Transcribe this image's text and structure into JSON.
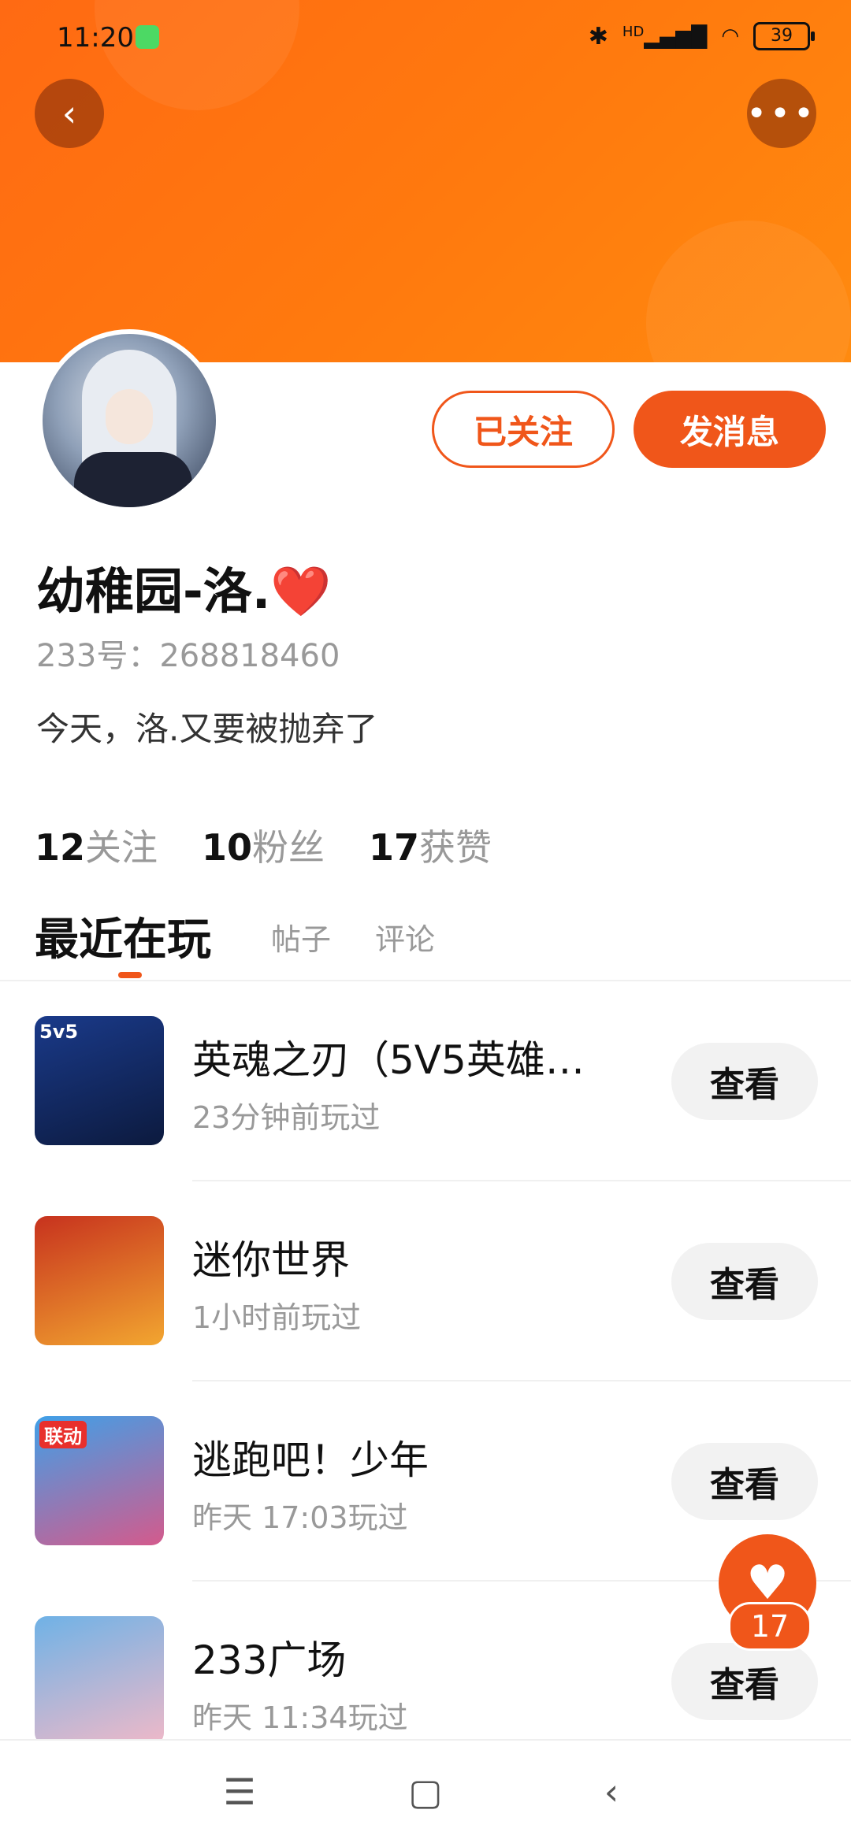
{
  "status_bar": {
    "time": "11:20",
    "signal_label": "HD",
    "battery": "39"
  },
  "header": {
    "back_icon": "chevron-left-icon",
    "more_icon": "more-dots-icon"
  },
  "profile": {
    "follow_button": "已关注",
    "message_button": "发消息",
    "name": "幼稚园-洛.",
    "name_emoji": "❤️",
    "uid": "233号：268818460",
    "bio": "今天，洛.又要被抛弃了"
  },
  "stats": [
    {
      "num": "12",
      "label": "关注"
    },
    {
      "num": "10",
      "label": "粉丝"
    },
    {
      "num": "17",
      "label": "获赞"
    }
  ],
  "tabs": {
    "active": "最近在玩",
    "posts": "帖子",
    "comments": "评论"
  },
  "games": [
    {
      "title": "英魂之刃（5V5英雄…",
      "time": "23分钟前玩过",
      "button": "查看",
      "icon_label": "5v5"
    },
    {
      "title": "迷你世界",
      "time": "1小时前玩过",
      "button": "查看",
      "icon_label": ""
    },
    {
      "title": "逃跑吧！少年",
      "time": "昨天 17:03玩过",
      "button": "查看",
      "icon_label": "联动"
    },
    {
      "title": "233广场",
      "time": "昨天 11:34玩过",
      "button": "查看",
      "icon_label": ""
    }
  ],
  "fab": {
    "count": "17",
    "icon": "heart-icon"
  },
  "colors": {
    "accent": "#f0561a",
    "header_start": "#ff6a13",
    "header_end": "#ff8a0f"
  }
}
